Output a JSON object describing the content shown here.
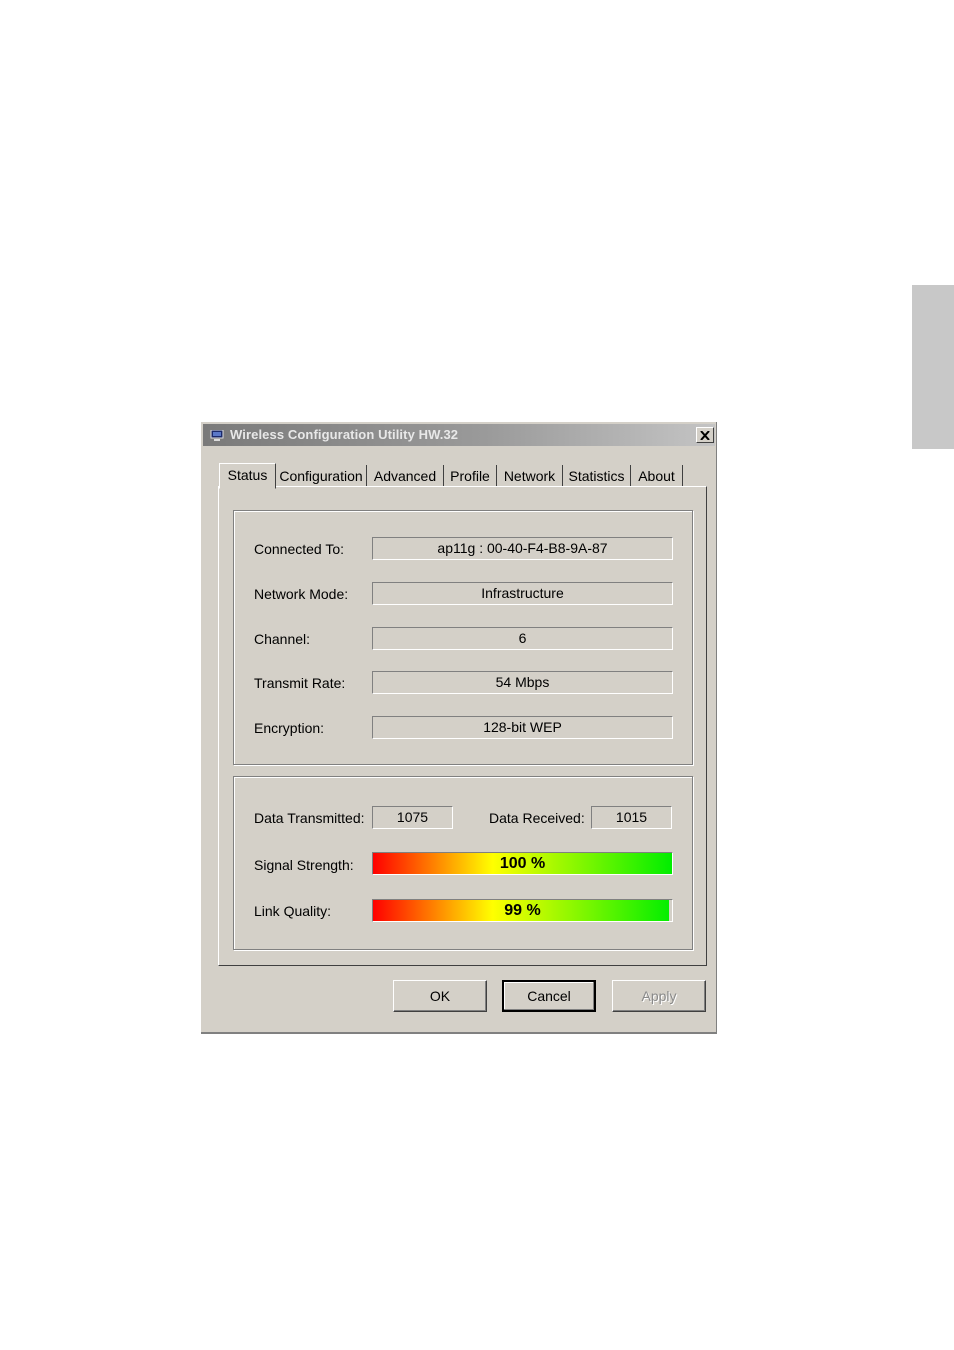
{
  "window": {
    "title": "Wireless Configuration Utility HW.32"
  },
  "tabs": [
    {
      "label": "Status",
      "active": true
    },
    {
      "label": "Configuration"
    },
    {
      "label": "Advanced"
    },
    {
      "label": "Profile"
    },
    {
      "label": "Network"
    },
    {
      "label": "Statistics"
    },
    {
      "label": "About"
    }
  ],
  "status": {
    "connected_to": {
      "label": "Connected To:",
      "value": "ap11g : 00-40-F4-B8-9A-87"
    },
    "network_mode": {
      "label": "Network Mode:",
      "value": "Infrastructure"
    },
    "channel": {
      "label": "Channel:",
      "value": "6"
    },
    "transmit_rate": {
      "label": "Transmit Rate:",
      "value": "54 Mbps"
    },
    "encryption": {
      "label": "Encryption:",
      "value": "128-bit WEP"
    }
  },
  "traffic": {
    "data_transmitted": {
      "label": "Data Transmitted:",
      "value": "1075"
    },
    "data_received": {
      "label": "Data Received:",
      "value": "1015"
    },
    "signal_strength": {
      "label": "Signal Strength:",
      "text": "100 %",
      "percent": 100
    },
    "link_quality": {
      "label": "Link Quality:",
      "text": "99 %",
      "percent": 99
    }
  },
  "buttons": {
    "ok": "OK",
    "cancel": "Cancel",
    "apply": "Apply"
  },
  "icons": {
    "app": "network-adapter-icon",
    "close": "close-icon"
  }
}
